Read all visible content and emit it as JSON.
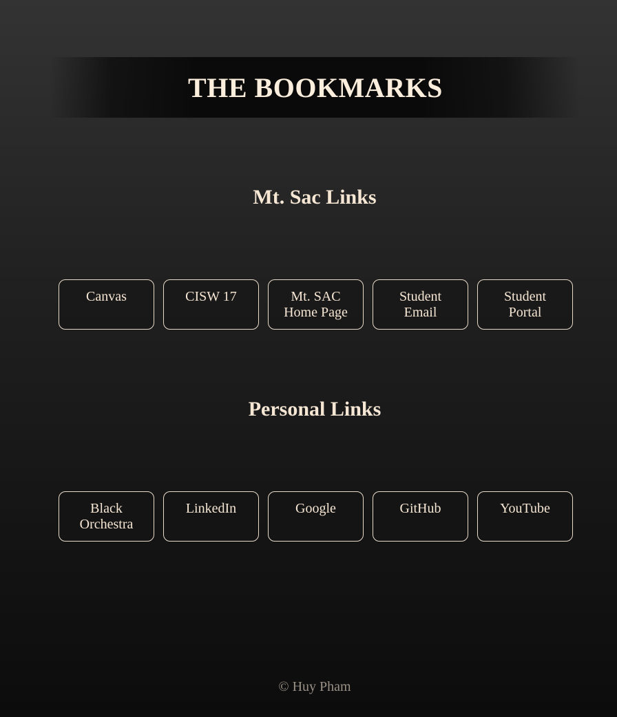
{
  "header": {
    "title": "THE BOOKMARKS"
  },
  "sections": [
    {
      "title": "Mt. Sac Links",
      "links": [
        {
          "label": "Canvas"
        },
        {
          "label": "CISW 17"
        },
        {
          "label": "Mt. SAC Home Page"
        },
        {
          "label": "Student Email"
        },
        {
          "label": "Student Portal"
        }
      ]
    },
    {
      "title": "Personal Links",
      "links": [
        {
          "label": "Black Orchestra"
        },
        {
          "label": "LinkedIn"
        },
        {
          "label": "Google"
        },
        {
          "label": "GitHub"
        },
        {
          "label": "YouTube"
        }
      ]
    }
  ],
  "footer": {
    "text": "© Huy Pham"
  },
  "colors": {
    "text_primary": "#f6e6d4",
    "footer_text": "#9a9186",
    "button_border": "#e9dccb",
    "banner_bg": "#0a0a0a"
  }
}
